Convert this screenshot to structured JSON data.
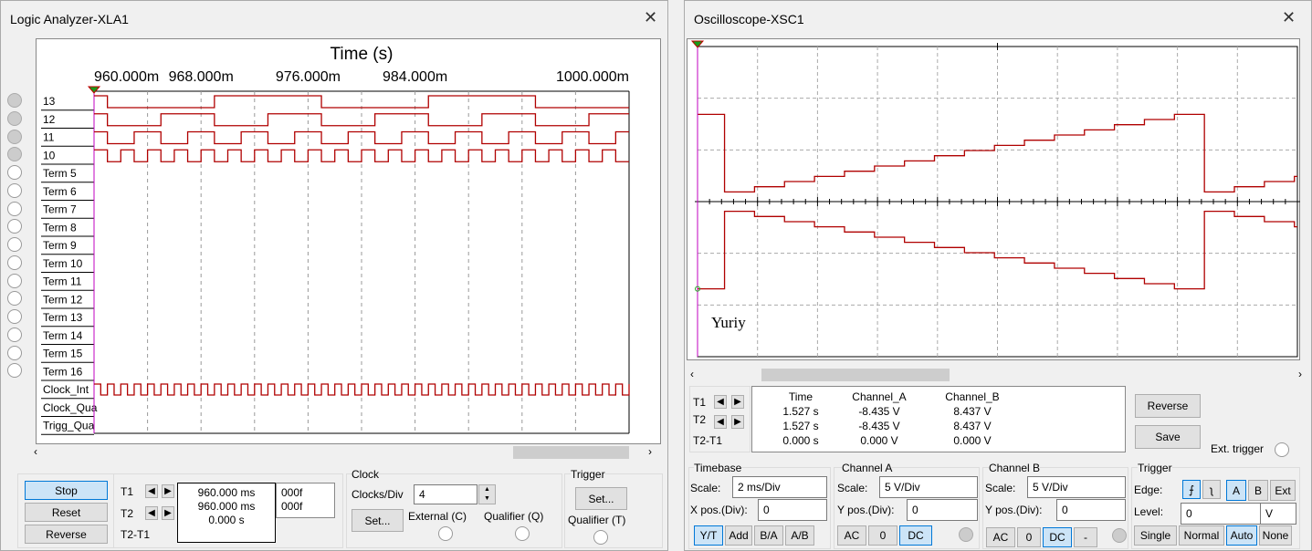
{
  "logic_analyzer": {
    "title": "Logic Analyzer-XLA1",
    "axis_title": "Time (s)",
    "tick_labels": [
      "960.000m",
      "968.000m",
      "976.000m",
      "984.000m",
      "1000.000m"
    ],
    "channels": [
      "13",
      "12",
      "11",
      "10",
      "Term 5",
      "Term 6",
      "Term 7",
      "Term 8",
      "Term 9",
      "Term 10",
      "Term 11",
      "Term 12",
      "Term 13",
      "Term 14",
      "Term 15",
      "Term 16",
      "Clock_Int",
      "Clock_Qua",
      "Trigg_Qua"
    ],
    "buttons": {
      "stop": "Stop",
      "reset": "Reset",
      "reverse": "Reverse"
    },
    "cursors": {
      "t1": "T1",
      "t2": "T2",
      "diff": "T2-T1",
      "t1_time": "960.000 ms",
      "t2_time": "960.000 ms",
      "diff_time": "0.000 s",
      "t1_hex": "000f",
      "t2_hex": "000f"
    },
    "clock": {
      "label": "Clock",
      "clocks_per_div_label": "Clocks/Div",
      "clocks_per_div": "4",
      "set": "Set...",
      "external": "External (C)",
      "qualifier": "Qualifier (Q)"
    },
    "trigger": {
      "label": "Trigger",
      "set": "Set...",
      "qualifier": "Qualifier (T)"
    }
  },
  "oscilloscope": {
    "title": "Oscilloscope-XSC1",
    "annotation": "Yuriy",
    "readout": {
      "headers": [
        "Time",
        "Channel_A",
        "Channel_B"
      ],
      "rows": [
        {
          "label": "T1",
          "time": "1.527 s",
          "a": "-8.435 V",
          "b": "8.437 V"
        },
        {
          "label": "T2",
          "time": "1.527 s",
          "a": "-8.435 V",
          "b": "8.437 V"
        },
        {
          "label": "T2-T1",
          "time": "0.000 s",
          "a": "0.000 V",
          "b": "0.000 V"
        }
      ]
    },
    "buttons": {
      "reverse": "Reverse",
      "save": "Save",
      "ext_trigger": "Ext. trigger"
    },
    "timebase": {
      "label": "Timebase",
      "scale_label": "Scale:",
      "scale": "2 ms/Div",
      "xpos_label": "X pos.(Div):",
      "xpos": "0",
      "modes": [
        "Y/T",
        "Add",
        "B/A",
        "A/B"
      ],
      "active_mode": "Y/T"
    },
    "channel_a": {
      "label": "Channel A",
      "scale_label": "Scale:",
      "scale": "5  V/Div",
      "ypos_label": "Y pos.(Div):",
      "ypos": "0",
      "coupling": [
        "AC",
        "0",
        "DC"
      ],
      "active": "DC"
    },
    "channel_b": {
      "label": "Channel B",
      "scale_label": "Scale:",
      "scale": "5  V/Div",
      "ypos_label": "Y pos.(Div):",
      "ypos": "0",
      "coupling": [
        "AC",
        "0",
        "DC",
        "-"
      ],
      "active": "DC"
    },
    "trigger": {
      "label": "Trigger",
      "edge_label": "Edge:",
      "edges": [
        "rising-edge",
        "falling-edge"
      ],
      "sources": [
        "A",
        "B",
        "Ext"
      ],
      "active_source": "A",
      "level_label": "Level:",
      "level": "0",
      "level_unit": "V",
      "modes": [
        "Single",
        "Normal",
        "Auto",
        "None"
      ],
      "active_mode": "Auto"
    }
  },
  "chart_data": [
    {
      "type": "line",
      "name": "logic-analyzer",
      "xunit": "ms",
      "xlim": [
        960,
        1000
      ],
      "step_ms": 1,
      "description_of_signals": "4-bit counter on channels 10 (LSB) to 13 (MSB), Clock_Int toggles each step",
      "counter_values": [
        15,
        0,
        1,
        2,
        3,
        4,
        5,
        6,
        7,
        8,
        9,
        10,
        11,
        12,
        13,
        14,
        15,
        0,
        1,
        2,
        3,
        4,
        5,
        6,
        7,
        8,
        9,
        10,
        11,
        12,
        13,
        14,
        15,
        0,
        1,
        2,
        3,
        4,
        5,
        6
      ],
      "trace_color": "#b00000"
    },
    {
      "type": "line",
      "name": "oscilloscope",
      "xunit": "ms",
      "xlim": [
        0,
        20
      ],
      "ylim": [
        -15,
        15
      ],
      "x_div": 2,
      "y_div": 5,
      "grid": true,
      "step_ms": 1,
      "first_step_ms": 0.9,
      "channel_b_levels_V": [
        8.44,
        0.94,
        1.44,
        1.94,
        2.44,
        2.94,
        3.44,
        3.94,
        4.44,
        4.94,
        5.44,
        5.94,
        6.44,
        6.94,
        7.44,
        7.94,
        8.44,
        0.94,
        1.44,
        1.94,
        2.44
      ],
      "channel_a_levels_V": [
        -8.44,
        -0.94,
        -1.44,
        -1.94,
        -2.44,
        -2.94,
        -3.44,
        -3.94,
        -4.44,
        -4.94,
        -5.44,
        -5.94,
        -6.44,
        -6.94,
        -7.44,
        -7.94,
        -8.44,
        -0.94,
        -1.44,
        -1.94,
        -2.44
      ],
      "trace_color": "#b00000"
    }
  ]
}
